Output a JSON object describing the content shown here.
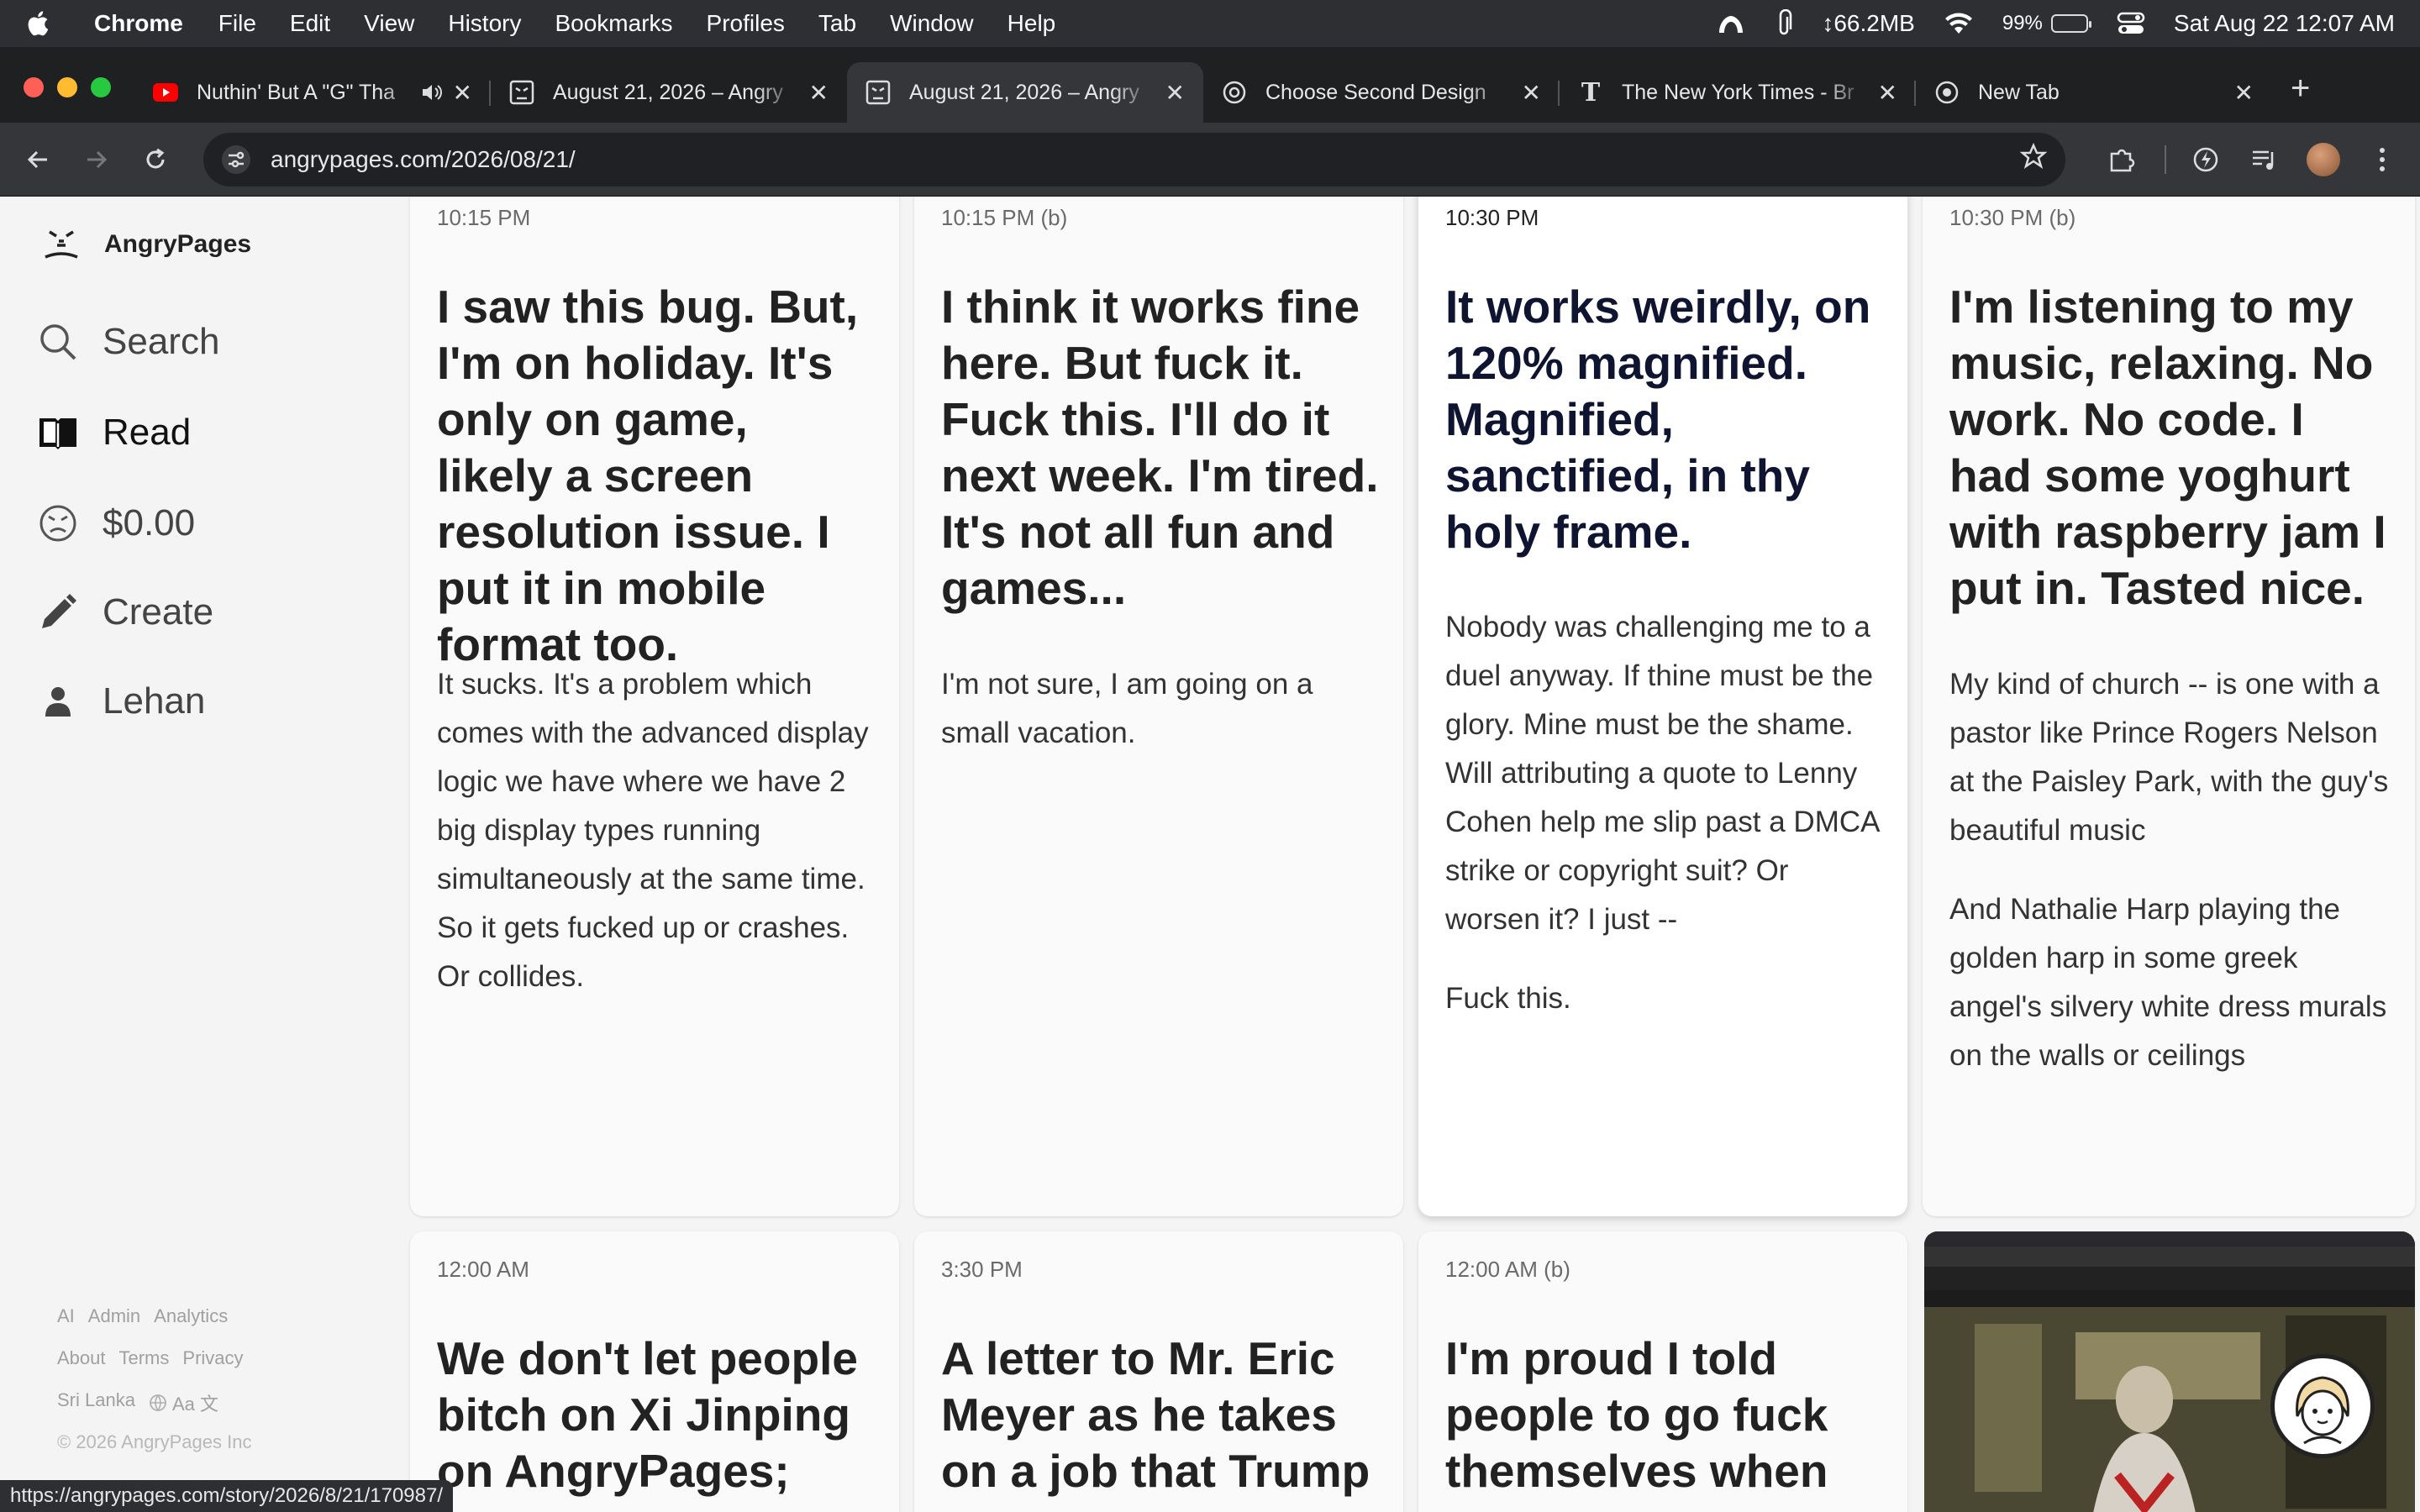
{
  "menubar": {
    "app_name": "Chrome",
    "menus": [
      "File",
      "Edit",
      "View",
      "History",
      "Bookmarks",
      "Profiles",
      "Tab",
      "Window",
      "Help"
    ],
    "memory": "↕66.2MB",
    "battery_percent": "99%",
    "datetime": "Sat Aug 22  12:07 AM"
  },
  "tabs": [
    {
      "title": "Nuthin' But A \"G\" Tha",
      "icon": "youtube-icon",
      "audio": true
    },
    {
      "title": "August 21, 2026 – Angry",
      "icon": "angrypages-icon"
    },
    {
      "title": "August 21, 2026 – Angry",
      "icon": "angrypages-icon",
      "active": true
    },
    {
      "title": "Choose Second Design",
      "icon": "openai-icon"
    },
    {
      "title": "The New York Times - Br",
      "icon": "nyt-icon"
    },
    {
      "title": "New Tab",
      "icon": "chrome-icon"
    }
  ],
  "address_bar": {
    "url": "angrypages.com/2026/08/21/"
  },
  "sidebar": {
    "brand": "AngryPages",
    "nav": [
      {
        "label": "Search",
        "icon": "search-icon"
      },
      {
        "label": "Read",
        "icon": "book-icon",
        "active": true
      },
      {
        "label": "$0.00",
        "icon": "angry-face-icon"
      },
      {
        "label": "Create",
        "icon": "pencil-icon"
      },
      {
        "label": "Lehan",
        "icon": "person-icon"
      }
    ],
    "footer_row1": [
      "AI",
      "Admin",
      "Analytics"
    ],
    "footer_row2": [
      "About",
      "Terms",
      "Privacy"
    ],
    "footer_row3": [
      "Sri Lanka",
      "Aa 文"
    ],
    "copyright": "© 2026 AngryPages Inc"
  },
  "posts": [
    {
      "time": "10:15 PM",
      "headline": "I saw this bug. But, I'm on holiday. It's only on game, likely a screen resolution issue. I put it in mobile format too.",
      "body": [
        "It sucks. It's a problem which comes with the advanced display logic we have where we have 2 big display types running simultaneously at the same time. So it gets fucked up or crashes. Or collides."
      ]
    },
    {
      "time": "10:15 PM (b)",
      "headline": "I think it works fine here. But fuck it. Fuck this. I'll do it next week. I'm tired. It's not all fun and games...",
      "body": [
        "I'm not sure, I am going on a small vacation."
      ]
    },
    {
      "time": "10:30 PM",
      "headline": "It works weirdly, on 120% magnified. Magnified, sanctified, in thy holy frame.",
      "body": [
        "Nobody was challenging me to a duel anyway. If thine must be the glory. Mine must be the shame. Will attributing a quote to Lenny Cohen help me slip past a DMCA strike or copyright suit? Or worsen it? I just --",
        "Fuck this."
      ]
    },
    {
      "time": "10:30 PM (b)",
      "headline": "I'm listening to my music, relaxing. No work. No code. I had some yoghurt with raspberry jam I put in. Tasted nice.",
      "body": [
        "My kind of church -- is one with a pastor like Prince Rogers Nelson at the Paisley Park, with the guy's beautiful music",
        "And Nathalie Harp playing the golden harp in some greek angel's silvery white dress murals on the walls or ceilings"
      ]
    },
    {
      "time": "12:00 AM",
      "headline": "We don't let people bitch on Xi Jinping on AngryPages;",
      "body": []
    },
    {
      "time": "3:30 PM",
      "headline": "A letter to Mr. Eric Meyer as he takes on a job that Trump",
      "body": []
    },
    {
      "time": "12:00 AM (b)",
      "headline": "I'm proud I told people to go fuck themselves when",
      "body": []
    }
  ],
  "status_url": "https://angrypages.com/story/2026/8/21/170987/"
}
